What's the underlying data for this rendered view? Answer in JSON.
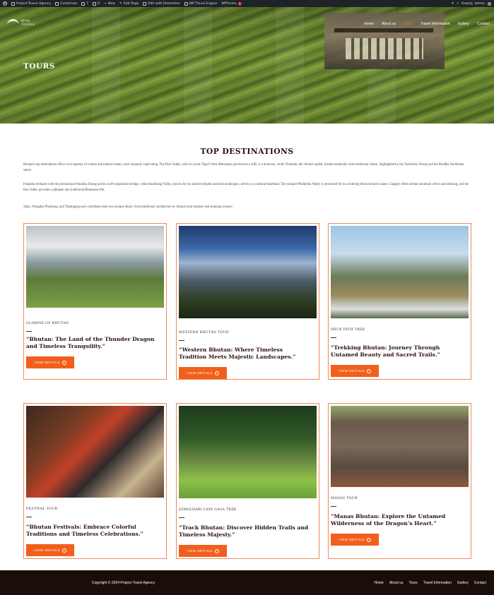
{
  "admin_bar": {
    "site_name": "Project-Travel Agency",
    "customize": "Customize",
    "comments_count": "7",
    "updates_count": "0",
    "new": "New",
    "edit_page": "Edit Page",
    "edit_elementor": "Edit with Elementor",
    "travel_engine": "WP Travel Engine",
    "wpforms": "WPForms",
    "wpforms_badge": "1",
    "howdy": "Howdy, admin"
  },
  "header": {
    "logo_text": "NEPAL TRAVELS",
    "nav": [
      "Home",
      "About us",
      "Tours",
      "Travel Information",
      "Gallery",
      "Contact"
    ],
    "active_nav": "Tours"
  },
  "hero": {
    "title": "TOURS"
  },
  "section": {
    "title": "TOP DESTINATIONS",
    "paragraphs": [
      "Bhutan's top destinations offer a rich tapestry of culture and natural beauty, each uniquely captivating. The Paro Valley, with its iconic Tiger's Nest Monastery perched on a cliff, is a must-see, while Thimphu, the vibrant capital, blends modernity with traditional charm, highlighted by the Tashichho Dzong and the Buddha Dordenma statue.",
      "Punakha enchants with the picturesque Punakha Dzong and its swift suspension bridge, while Bumthang Valley, known for its ancient temples and lush landscapes, serves as a cultural heartland. The tranquil Phobjikha Valley is renowned for its wintering black-necked cranes. Gangtey offers serene mountain views and trekking, and the Haa Valley provides a glimpse into traditional Bhutanese life.",
      "Jakar, Wangdue Phodrang, and Trashigang each contribute their own unique allure, from traditional architecture to vibrant local markets and stunning scenery."
    ]
  },
  "cards": [
    {
      "tag": "GLIMPSE OF BHUTAN",
      "title": "“Bhutan: The Land of the Thunder Dragon and Timeless Tranquility.”",
      "button": "VIEW DETAILS",
      "image": "valley-village"
    },
    {
      "tag": "WESTERN BHUTAN TOUR",
      "title": "“Western Bhutan: Where Timeless Tradition Meets Majestic Landscapes.”",
      "button": "VIEW DETAILS",
      "image": "mountain-vista"
    },
    {
      "tag": "DRUK PATH TREK",
      "title": "“Trekking Bhutan: Journey Through Untamed Beauty and Sacred Trails.”",
      "button": "VIEW DETAILS",
      "image": "river-forest"
    },
    {
      "tag": "FESTIVAL TOUR",
      "title": "“Bhutan Festivals: Embrace Colorful Traditions and Timeless Celebrations.”",
      "button": "VIEW DETAILS",
      "image": "masked-dancer"
    },
    {
      "tag": "JOMOLHARI LAYA GASA TREK",
      "title": "“Track Bhutan: Discover Hidden Trails and Timeless Majesty.”",
      "button": "VIEW DETAILS",
      "image": "hikers-meadow"
    },
    {
      "tag": "MANAS TOUR",
      "title": "“Manas Bhutan: Explore the Untamed Wilderness of the Dragon’s Heart.”",
      "button": "VIEW DETAILS",
      "image": "elephants"
    }
  ],
  "footer": {
    "copyright": "Copyright © 2024 Project-Travel Agency",
    "nav": [
      "Home",
      "About us",
      "Tours",
      "Travel Information",
      "Gallery",
      "Contact"
    ]
  },
  "colors": {
    "accent": "#f25f1c",
    "card_border": "#f08a55",
    "footer_bg": "#1a0e0a",
    "admin_bar": "#1d2327"
  }
}
